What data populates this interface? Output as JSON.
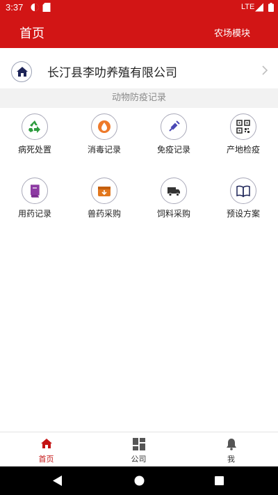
{
  "status": {
    "time": "3:37",
    "network": "LTE"
  },
  "appbar": {
    "title": "首页",
    "module": "农场模块"
  },
  "company": {
    "name": "长汀县李叻养殖有限公司",
    "icon": "home-icon"
  },
  "section": {
    "title": "动物防疫记录"
  },
  "grid": {
    "items": [
      {
        "label": "病死处置",
        "icon": "recycle-icon"
      },
      {
        "label": "消毒记录",
        "icon": "drop-icon"
      },
      {
        "label": "免疫记录",
        "icon": "syringe-icon"
      },
      {
        "label": "产地检疫",
        "icon": "qrcode-icon"
      },
      {
        "label": "用药记录",
        "icon": "book-icon"
      },
      {
        "label": "兽药采购",
        "icon": "box-icon"
      },
      {
        "label": "饲料采购",
        "icon": "truck-icon"
      },
      {
        "label": "预设方案",
        "icon": "open-book-icon"
      }
    ]
  },
  "tabs": [
    {
      "label": "首页",
      "icon": "home-icon",
      "active": true
    },
    {
      "label": "公司",
      "icon": "dashboard-icon",
      "active": false
    },
    {
      "label": "我",
      "icon": "bell-icon",
      "active": false
    }
  ],
  "colors": {
    "brand": "#d21515",
    "active_tab": "#c41414"
  }
}
